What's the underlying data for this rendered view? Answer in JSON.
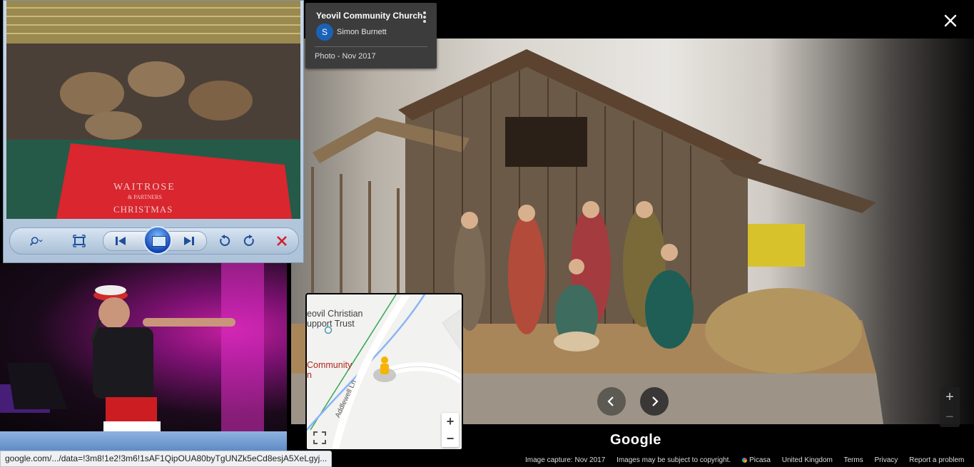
{
  "info_card": {
    "title": "Yeovil Community Church",
    "avatar_letter": "S",
    "author": "Simon Burnett",
    "date": "Photo - Nov 2017"
  },
  "viewer": {
    "jar_label_line1": "WAITROSE",
    "jar_label_line2": "& PARTNERS",
    "jar_label_line3": "CHRISTMAS"
  },
  "minimap": {
    "poi_trust": "eovil Christian\nupport Trust",
    "poi_community": "Community\nn",
    "road": "Addlewell Ln"
  },
  "zoom": {
    "plus": "+",
    "minus": "−"
  },
  "brand": "Google",
  "footer": {
    "capture": "Image capture: Nov 2017",
    "copyright": "Images may be subject to copyright.",
    "picasa": "Picasa",
    "country": "United Kingdom",
    "terms": "Terms",
    "privacy": "Privacy",
    "report": "Report a problem"
  },
  "status_url": "google.com/.../data=!3m8!1e2!3m6!1sAF1QipOUA80byTgUNZk5eCd8esjA5XeLgyj...",
  "colors": {
    "accent": "#1a62b8",
    "bg": "#000000"
  }
}
